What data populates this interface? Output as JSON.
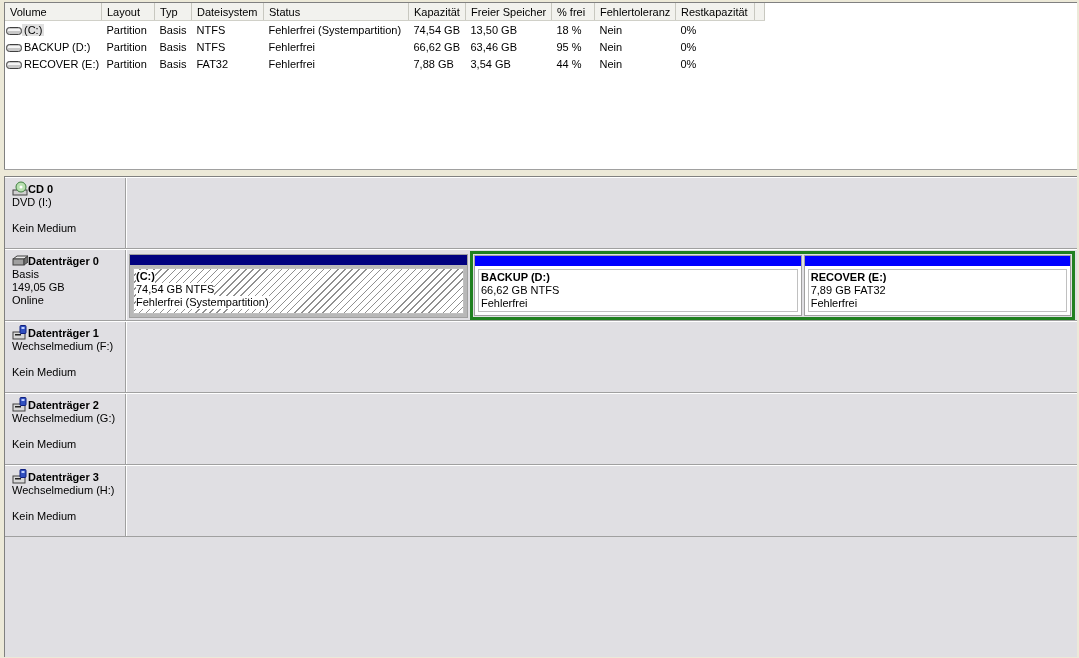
{
  "volume_list": {
    "columns": [
      "Volume",
      "Layout",
      "Typ",
      "Dateisystem",
      "Status",
      "Kapazität",
      "Freier Speicher",
      "% frei",
      "Fehlertoleranz",
      "Restkapazität"
    ],
    "rows": [
      {
        "selected": true,
        "cells": [
          "(C:)",
          "Partition",
          "Basis",
          "NTFS",
          "Fehlerfrei (Systempartition)",
          "74,54 GB",
          "13,50 GB",
          "18 %",
          "Nein",
          "0%"
        ]
      },
      {
        "selected": false,
        "cells": [
          "BACKUP (D:)",
          "Partition",
          "Basis",
          "NTFS",
          "Fehlerfrei",
          "66,62 GB",
          "63,46 GB",
          "95 %",
          "Nein",
          "0%"
        ]
      },
      {
        "selected": false,
        "cells": [
          "RECOVER (E:)",
          "Partition",
          "Basis",
          "FAT32",
          "Fehlerfrei",
          "7,88 GB",
          "3,54 GB",
          "44 %",
          "Nein",
          "0%"
        ]
      }
    ]
  },
  "disks": [
    {
      "kind": "cd",
      "name": "CD 0",
      "info": [
        "DVD (I:)"
      ],
      "status": "Kein Medium"
    },
    {
      "kind": "hdd",
      "name": "Datenträger 0",
      "info": [
        "Basis",
        "149,05 GB"
      ],
      "status": "Online",
      "partitions": [
        {
          "kind": "primary",
          "selected": true,
          "name": "(C:)",
          "size": "74,54 GB NTFS",
          "status": "Fehlerfrei (Systempartition)"
        },
        {
          "kind": "logical",
          "selected": false,
          "name": "BACKUP  (D:)",
          "size": "66,62 GB NTFS",
          "status": "Fehlerfrei"
        },
        {
          "kind": "logical",
          "selected": false,
          "name": "RECOVER  (E:)",
          "size": "7,89 GB FAT32",
          "status": "Fehlerfrei"
        }
      ]
    },
    {
      "kind": "removable",
      "name": "Datenträger 1",
      "info": [
        "Wechselmedium (F:)"
      ],
      "status": "Kein Medium"
    },
    {
      "kind": "removable",
      "name": "Datenträger 2",
      "info": [
        "Wechselmedium (G:)"
      ],
      "status": "Kein Medium"
    },
    {
      "kind": "removable",
      "name": "Datenträger 3",
      "info": [
        "Wechselmedium (H:)"
      ],
      "status": "Kein Medium"
    }
  ]
}
